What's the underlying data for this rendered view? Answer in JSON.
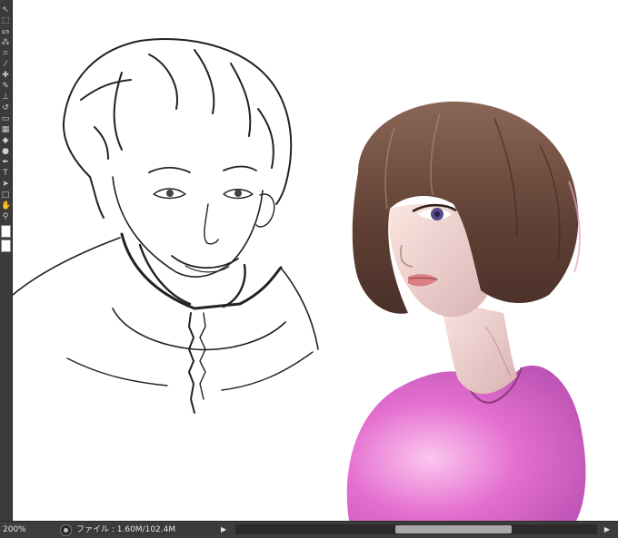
{
  "toolbar": {
    "tools": [
      {
        "name": "move-tool-icon",
        "glyph": "↖"
      },
      {
        "name": "marquee-tool-icon",
        "glyph": "⬚"
      },
      {
        "name": "lasso-tool-icon",
        "glyph": "ᔕ"
      },
      {
        "name": "magic-wand-tool-icon",
        "glyph": "⁂"
      },
      {
        "name": "crop-tool-icon",
        "glyph": "⌗"
      },
      {
        "name": "eyedropper-tool-icon",
        "glyph": "⁄"
      },
      {
        "name": "healing-tool-icon",
        "glyph": "✚"
      },
      {
        "name": "brush-tool-icon",
        "glyph": "✎"
      },
      {
        "name": "stamp-tool-icon",
        "glyph": "⊥"
      },
      {
        "name": "history-brush-tool-icon",
        "glyph": "↺"
      },
      {
        "name": "eraser-tool-icon",
        "glyph": "▭"
      },
      {
        "name": "gradient-tool-icon",
        "glyph": "▦"
      },
      {
        "name": "blur-tool-icon",
        "glyph": "◆"
      },
      {
        "name": "dodge-tool-icon",
        "glyph": "●"
      },
      {
        "name": "pen-tool-icon",
        "glyph": "✒"
      },
      {
        "name": "type-tool-icon",
        "glyph": "T"
      },
      {
        "name": "path-selection-tool-icon",
        "glyph": "➤"
      },
      {
        "name": "shape-tool-icon",
        "glyph": "□"
      },
      {
        "name": "hand-tool-icon",
        "glyph": "✋"
      },
      {
        "name": "zoom-tool-icon",
        "glyph": "⚲"
      }
    ],
    "foreground_color": "#ffffff",
    "background_color": "#ffffff"
  },
  "status": {
    "zoom": "200%",
    "file_info": "ファイル : 1.60M/102.4M",
    "scroll_position": 0.65
  },
  "colors": {
    "shirt_pink": "#e46fd0",
    "hair_brown": "#6b4a3a",
    "skin": "#f3d9d2",
    "line": "#222222"
  }
}
